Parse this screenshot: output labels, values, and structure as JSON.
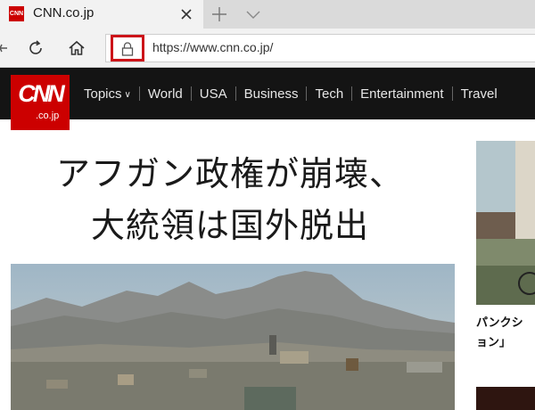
{
  "browser": {
    "tab": {
      "title": "CNN.co.jp",
      "favicon_text": "CNN"
    },
    "address": {
      "url": "https://www.cnn.co.jp/"
    }
  },
  "site": {
    "logo": {
      "main": "CNN",
      "sub": ".co.jp"
    },
    "nav": [
      {
        "label": "Topics",
        "has_dropdown": true
      },
      {
        "label": "World"
      },
      {
        "label": "USA"
      },
      {
        "label": "Business"
      },
      {
        "label": "Tech"
      },
      {
        "label": "Entertainment"
      },
      {
        "label": "Travel"
      }
    ]
  },
  "main": {
    "headline_line1": "アフガン政権が崩壊、",
    "headline_line2": "大統領は国外脱出"
  },
  "side": {
    "caption_line1": "パンクシ",
    "caption_line2": "ョン」"
  },
  "colors": {
    "cnn_red": "#cc0000",
    "highlight_red": "#cc1419",
    "header_bg": "#141414"
  }
}
